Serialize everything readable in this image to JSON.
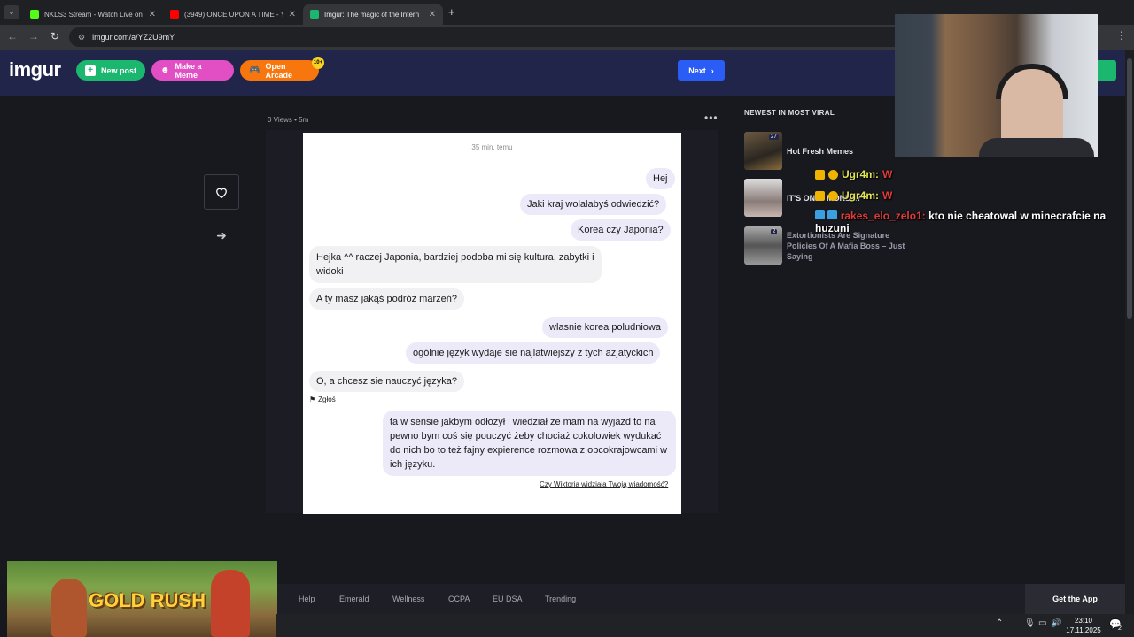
{
  "browser": {
    "tabs": [
      {
        "title": "NKLS3 Stream - Watch Live on K",
        "color": "#53fc18"
      },
      {
        "title": "(3949) ONCE UPON A TIME - Yo",
        "color": "#ff0000"
      },
      {
        "title": "Imgur: The magic of the Intern",
        "color": "#1bb76e"
      }
    ],
    "url": "imgur.com/a/YZ2U9mY"
  },
  "imgur": {
    "logo": "imgur",
    "new_post": "New post",
    "make_meme": "Make a Meme",
    "open_arcade": "Open Arcade",
    "arcade_badge": "10+",
    "next": "Next",
    "post_meta": "0 Views • 5m",
    "sidebar_title": "NEWEST IN MOST VIRAL",
    "sidebar_items": [
      {
        "title": "Hot Fresh Memes",
        "count": "27"
      },
      {
        "title": "IT'S ONLY MONDAY",
        "count": ""
      },
      {
        "title": "Extortionists Are Signature Policies Of A Mafia Boss – Just Saying",
        "count": "2"
      }
    ]
  },
  "chat": {
    "time": "35 min. temu",
    "messages": [
      {
        "dir": "out",
        "text": "Hej"
      },
      {
        "dir": "out",
        "text": "Jaki kraj wolałabyś odwiedzić?"
      },
      {
        "dir": "out",
        "text": "Korea czy Japonia?"
      },
      {
        "dir": "in",
        "text": "Hejka ^^ raczej Japonia, bardziej podoba mi się kultura, zabytki i widoki"
      },
      {
        "dir": "in",
        "text": "A ty masz jakąś podróż marzeń?"
      },
      {
        "dir": "out",
        "text": "wlasnie korea poludniowa"
      },
      {
        "dir": "out",
        "text": "ogólnie język wydaje sie najlatwiejszy z tych azjatyckich"
      },
      {
        "dir": "in",
        "text": "O, a chcesz sie nauczyć języka?"
      },
      {
        "dir": "out",
        "text": "ta w sensie jakbym odłożył i wiedział że mam na wyjazd to na pewno bym coś się pouczyć żeby chociaż cokolowiek wydukać do nich bo to też fajny expierence rozmowa z obcokrajowcami w ich języku."
      }
    ],
    "report": "Zgłoś",
    "seen": "Czy Wiktoria widziała Twoją wiadomość?"
  },
  "stream_chat": [
    {
      "user": "Ugr4m:",
      "msg": "W",
      "user_color": "#e4e45a"
    },
    {
      "user": "Ugr4m:",
      "msg": "W",
      "user_color": "#e4e45a"
    },
    {
      "user": "rakes_elo_zelo1:",
      "msg": "kto nie cheatowal w minecrafcie na huzuni",
      "user_color": "#e03a3a"
    }
  ],
  "footer": {
    "links": [
      "Help",
      "Emerald",
      "Wellness",
      "CCPA",
      "EU DSA",
      "Trending"
    ],
    "get_app": "Get the App"
  },
  "ad": {
    "text": "GOLD RUSH"
  },
  "taskbar": {
    "time": "23:10",
    "date": "17.11.2025",
    "notif_count": "2"
  }
}
